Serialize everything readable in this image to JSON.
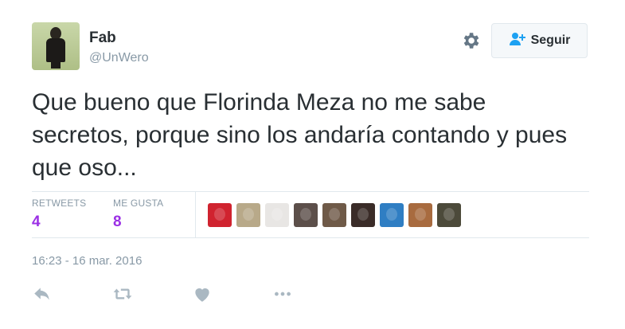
{
  "user": {
    "name": "Fab",
    "handle": "@UnWero"
  },
  "header": {
    "follow_label": "Seguir",
    "settings_icon": "gear-icon",
    "follow_icon": "add-user-icon"
  },
  "tweet": {
    "text": "Que bueno que Florinda Meza no me sabe secretos, porque sino los andaría contando y pues que oso..."
  },
  "stats": {
    "retweets_label": "RETWEETS",
    "retweets_count": "4",
    "likes_label": "ME GUSTA",
    "likes_count": "8"
  },
  "likers": [
    {
      "name": "liker-avatar-1",
      "color": "#d0232f"
    },
    {
      "name": "liker-avatar-2",
      "color": "#b8a989"
    },
    {
      "name": "liker-avatar-3",
      "color": "#e8e6e4"
    },
    {
      "name": "liker-avatar-4",
      "color": "#5c4f4a"
    },
    {
      "name": "liker-avatar-5",
      "color": "#6f5a48"
    },
    {
      "name": "liker-avatar-6",
      "color": "#3a2c28"
    },
    {
      "name": "liker-avatar-7",
      "color": "#2f7ec3"
    },
    {
      "name": "liker-avatar-8",
      "color": "#a86b3f"
    },
    {
      "name": "liker-avatar-9",
      "color": "#4c4a3a"
    }
  ],
  "timestamp": "16:23 - 16 mar. 2016",
  "actions": [
    "reply-icon",
    "retweet-icon",
    "like-icon",
    "more-icon"
  ],
  "colors": {
    "accent": "#9b30e5",
    "muted": "#8899a6",
    "icon": "#aab8c2",
    "text": "#292f33"
  }
}
